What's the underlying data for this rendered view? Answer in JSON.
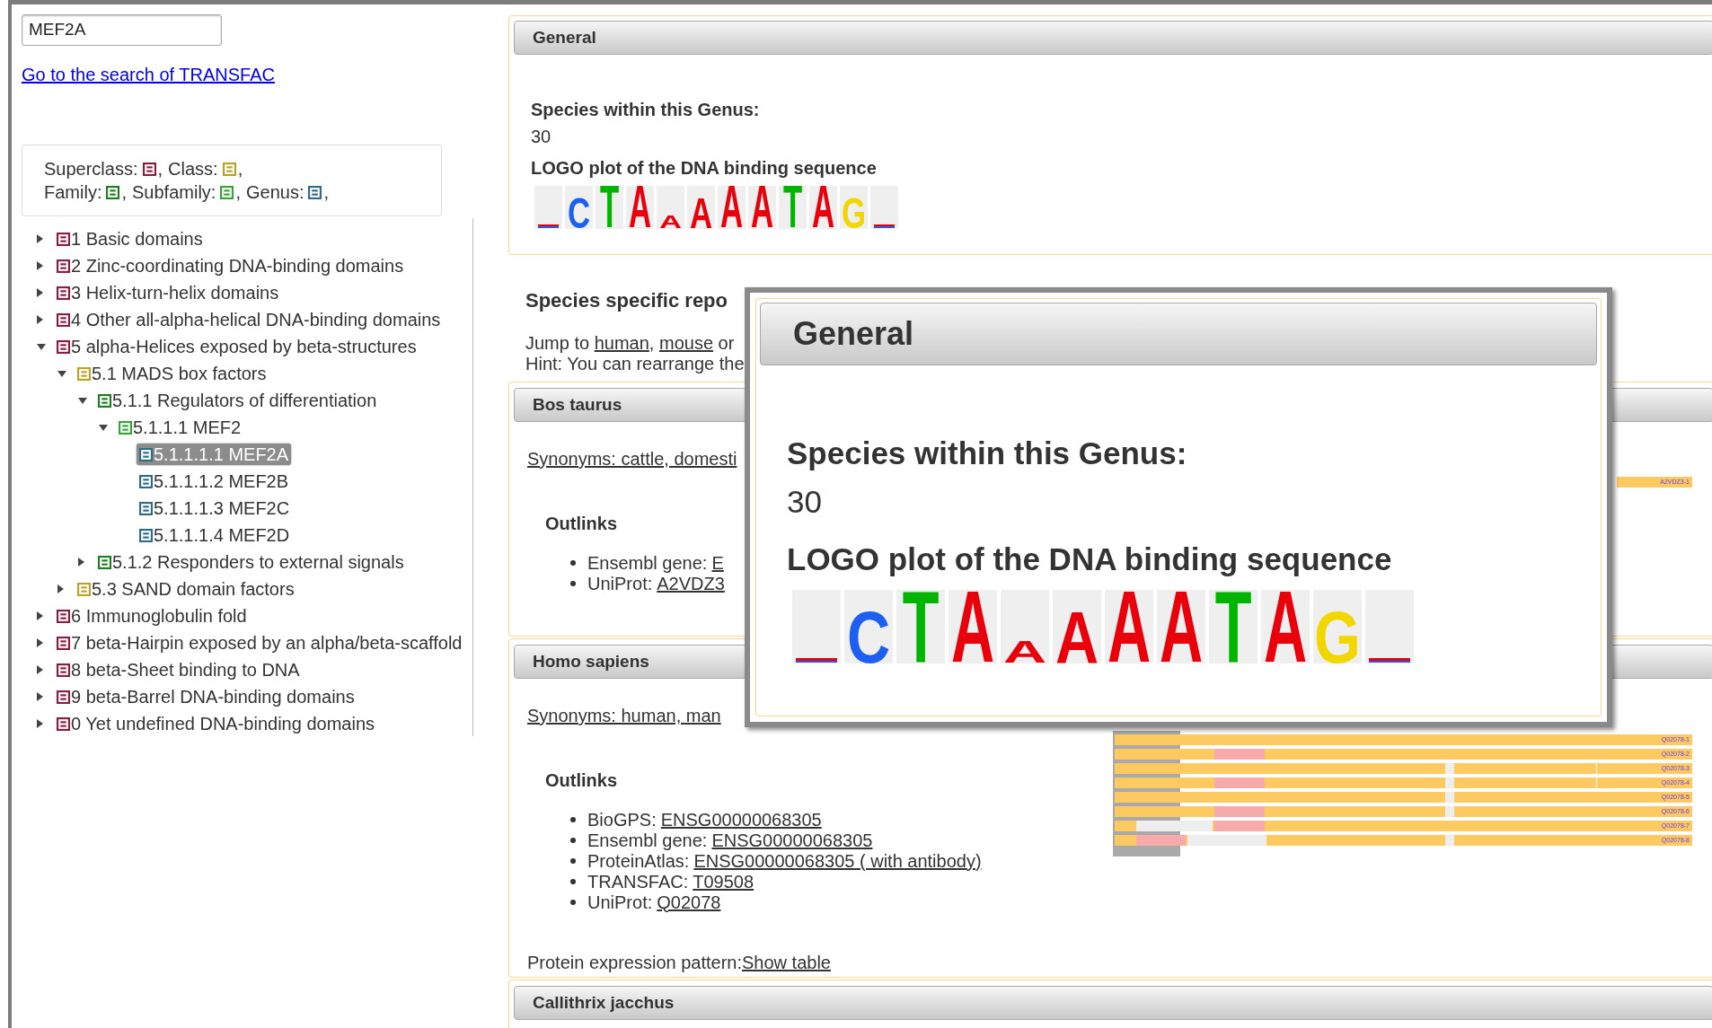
{
  "search": {
    "value": "MEF2A"
  },
  "search_link": "Go to the search of TRANSFAC",
  "legend": [
    [
      {
        "label": "Superclass:",
        "kind": "superclass",
        "after": ","
      },
      {
        "label": "Class:",
        "kind": "class",
        "after": ","
      }
    ],
    [
      {
        "label": "Family:",
        "kind": "family",
        "after": ","
      },
      {
        "label": "Subfamily:",
        "kind": "subfamily",
        "after": ","
      },
      {
        "label": "Genus:",
        "kind": "genus",
        "after": ","
      }
    ]
  ],
  "tree": [
    {
      "label": "1 Basic domains",
      "kind": "superclass",
      "expanded": false,
      "selected": false
    },
    {
      "label": "2 Zinc-coordinating DNA-binding domains",
      "kind": "superclass",
      "expanded": false,
      "selected": false
    },
    {
      "label": "3 Helix-turn-helix domains",
      "kind": "superclass",
      "expanded": false,
      "selected": false
    },
    {
      "label": "4 Other all-alpha-helical DNA-binding domains",
      "kind": "superclass",
      "expanded": false,
      "selected": false
    },
    {
      "label": "5 alpha-Helices exposed by beta-structures",
      "kind": "superclass",
      "expanded": true,
      "selected": false,
      "children": [
        {
          "label": "5.1 MADS box factors",
          "kind": "class",
          "expanded": true,
          "selected": false,
          "children": [
            {
              "label": "5.1.1 Regulators of differentiation",
              "kind": "family",
              "expanded": true,
              "selected": false,
              "children": [
                {
                  "label": "5.1.1.1 MEF2",
                  "kind": "subfamily",
                  "expanded": true,
                  "selected": false,
                  "children": [
                    {
                      "label": "5.1.1.1.1 MEF2A",
                      "kind": "genus",
                      "selected": true
                    },
                    {
                      "label": "5.1.1.1.2 MEF2B",
                      "kind": "genus",
                      "selected": false
                    },
                    {
                      "label": "5.1.1.1.3 MEF2C",
                      "kind": "genus",
                      "selected": false
                    },
                    {
                      "label": "5.1.1.1.4 MEF2D",
                      "kind": "genus",
                      "selected": false
                    }
                  ]
                }
              ]
            },
            {
              "label": "5.1.2 Responders to external signals",
              "kind": "family",
              "expanded": false,
              "selected": false
            }
          ]
        },
        {
          "label": "5.3 SAND domain factors",
          "kind": "class",
          "expanded": false,
          "selected": false
        }
      ]
    },
    {
      "label": "6 Immunoglobulin fold",
      "kind": "superclass",
      "expanded": false,
      "selected": false
    },
    {
      "label": "7 beta-Hairpin exposed by an alpha/beta-scaffold",
      "kind": "superclass",
      "expanded": false,
      "selected": false
    },
    {
      "label": "8 beta-Sheet binding to DNA",
      "kind": "superclass",
      "expanded": false,
      "selected": false
    },
    {
      "label": "9 beta-Barrel DNA-binding domains",
      "kind": "superclass",
      "expanded": false,
      "selected": false
    },
    {
      "label": "0 Yet undefined DNA-binding domains",
      "kind": "superclass",
      "expanded": false,
      "selected": false
    }
  ],
  "general": {
    "title": "General",
    "species_label": "Species within this Genus:",
    "species_count": "30",
    "logo_title": "LOGO plot of the DNA binding sequence",
    "logo": [
      {
        "kind": "tiny"
      },
      {
        "letter": "C",
        "color": "#1d5ff0",
        "kind": "medium"
      },
      {
        "letter": "T",
        "color": "#00b400",
        "kind": "tall"
      },
      {
        "letter": "A",
        "color": "#e8000b",
        "kind": "tall"
      },
      {
        "letter": "A",
        "color": "#e8000b",
        "kind": "small"
      },
      {
        "letter": "A",
        "color": "#e8000b",
        "kind": "medium"
      },
      {
        "letter": "A",
        "color": "#e8000b",
        "kind": "tall"
      },
      {
        "letter": "A",
        "color": "#e8000b",
        "kind": "tall"
      },
      {
        "letter": "T",
        "color": "#00b400",
        "kind": "tall"
      },
      {
        "letter": "A",
        "color": "#e8000b",
        "kind": "tall"
      },
      {
        "letter": "G",
        "color": "#f2d600",
        "kind": "medium"
      },
      {
        "kind": "tiny"
      }
    ]
  },
  "species_reports": {
    "title": "Species specific repo",
    "jump": [
      {
        "text": "Jump to ",
        "kind": "plain"
      },
      {
        "text": "human",
        "kind": "link"
      },
      {
        "text": ", ",
        "kind": "plain"
      },
      {
        "text": "mouse",
        "kind": "link"
      },
      {
        "text": " or",
        "kind": "plain"
      }
    ],
    "hint": "Hint: You can rearrange the"
  },
  "panels": [
    {
      "title": "Bos taurus",
      "synonyms": "Synonyms: cattle, domesti",
      "outlinks_title": "Outlinks",
      "outlinks": [
        {
          "label": "Ensembl gene:",
          "link": "E"
        },
        {
          "label": "UniProt:",
          "link": "A2VDZ3"
        }
      ],
      "isoforms": [
        {
          "label": "A2VDZ3-1"
        }
      ]
    },
    {
      "title": "Homo sapiens",
      "synonyms": "Synonyms: human, man",
      "outlinks_title": "Outlinks",
      "outlinks": [
        {
          "label": "BioGPS:",
          "link": "ENSG00000068305"
        },
        {
          "label": "Ensembl gene:",
          "link": "ENSG00000068305"
        },
        {
          "label": "ProteinAtlas:",
          "link": "ENSG00000068305 ( with antibody)"
        },
        {
          "label": "TRANSFAC:",
          "link": "T09508"
        },
        {
          "label": "UniProt:",
          "link": "Q02078"
        }
      ],
      "isoforms": [
        {
          "label": "Q02078-1"
        },
        {
          "label": "Q02078-2"
        },
        {
          "label": "Q02078-3"
        },
        {
          "label": "Q02078-4"
        },
        {
          "label": "Q02078-5"
        },
        {
          "label": "Q02078-6"
        },
        {
          "label": "Q02078-7"
        },
        {
          "label": "Q02078-8"
        }
      ],
      "expression": {
        "label": "Protein expression pattern:",
        "link": "Show table"
      }
    },
    {
      "title": "Callithrix jacchus"
    }
  ],
  "overlay": {
    "title": "General",
    "species_label": "Species within this Genus:",
    "species_count": "30",
    "logo_title": "LOGO plot of the DNA binding sequence",
    "logo": [
      {
        "kind": "tiny"
      },
      {
        "letter": "C",
        "color": "#1d5ff0",
        "kind": "medium"
      },
      {
        "letter": "T",
        "color": "#00b400",
        "kind": "tall"
      },
      {
        "letter": "A",
        "color": "#e8000b",
        "kind": "tall"
      },
      {
        "letter": "A",
        "color": "#e8000b",
        "kind": "small"
      },
      {
        "letter": "A",
        "color": "#e8000b",
        "kind": "medium"
      },
      {
        "letter": "A",
        "color": "#e8000b",
        "kind": "tall"
      },
      {
        "letter": "A",
        "color": "#e8000b",
        "kind": "tall"
      },
      {
        "letter": "T",
        "color": "#00b400",
        "kind": "tall"
      },
      {
        "letter": "A",
        "color": "#e8000b",
        "kind": "tall"
      },
      {
        "letter": "G",
        "color": "#f2d600",
        "kind": "medium"
      },
      {
        "kind": "tiny"
      }
    ]
  }
}
